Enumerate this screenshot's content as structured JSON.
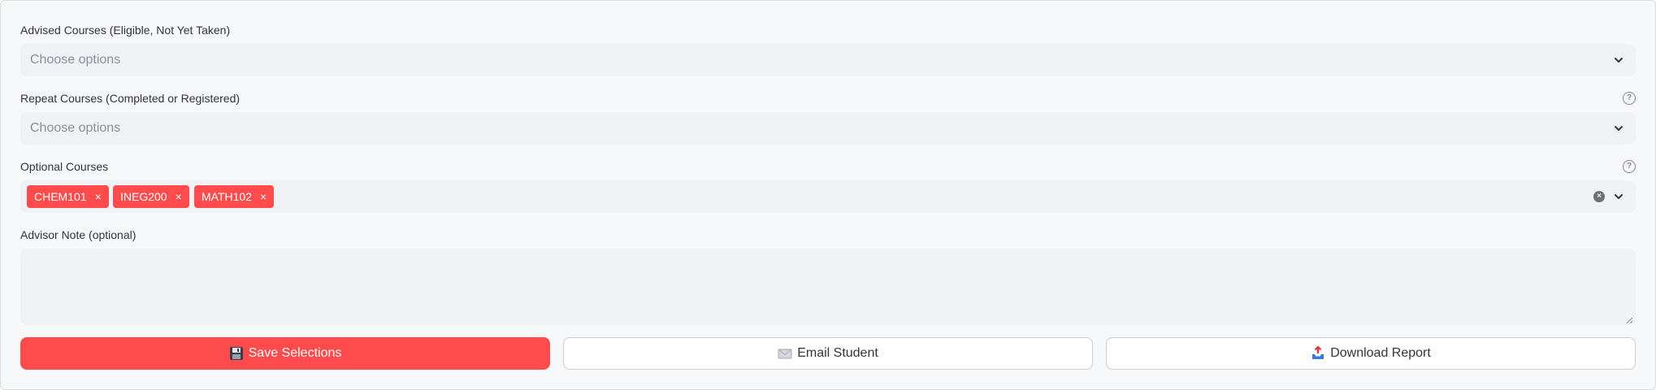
{
  "colors": {
    "accent": "#ff4b4b",
    "field_bg": "#f0f2f6",
    "panel_bg": "#f7f8fa",
    "text": "#31333f",
    "placeholder": "#8a8f9b"
  },
  "advised": {
    "label": "Advised Courses (Eligible, Not Yet Taken)",
    "placeholder": "Choose options"
  },
  "repeat": {
    "label": "Repeat Courses (Completed or Registered)",
    "placeholder": "Choose options",
    "help_icon": "question-circle-icon"
  },
  "optional": {
    "label": "Optional Courses",
    "help_icon": "question-circle-icon",
    "tags": [
      "CHEM101",
      "INEG200",
      "MATH102"
    ],
    "tag_remove": "×"
  },
  "note": {
    "label": "Advisor Note (optional)",
    "value": ""
  },
  "actions": {
    "save": {
      "icon": "floppy-disk-icon",
      "label": "Save Selections"
    },
    "email": {
      "icon": "envelope-icon",
      "label": "Email Student"
    },
    "download": {
      "icon": "outbox-tray-icon",
      "label": "Download Report"
    }
  }
}
